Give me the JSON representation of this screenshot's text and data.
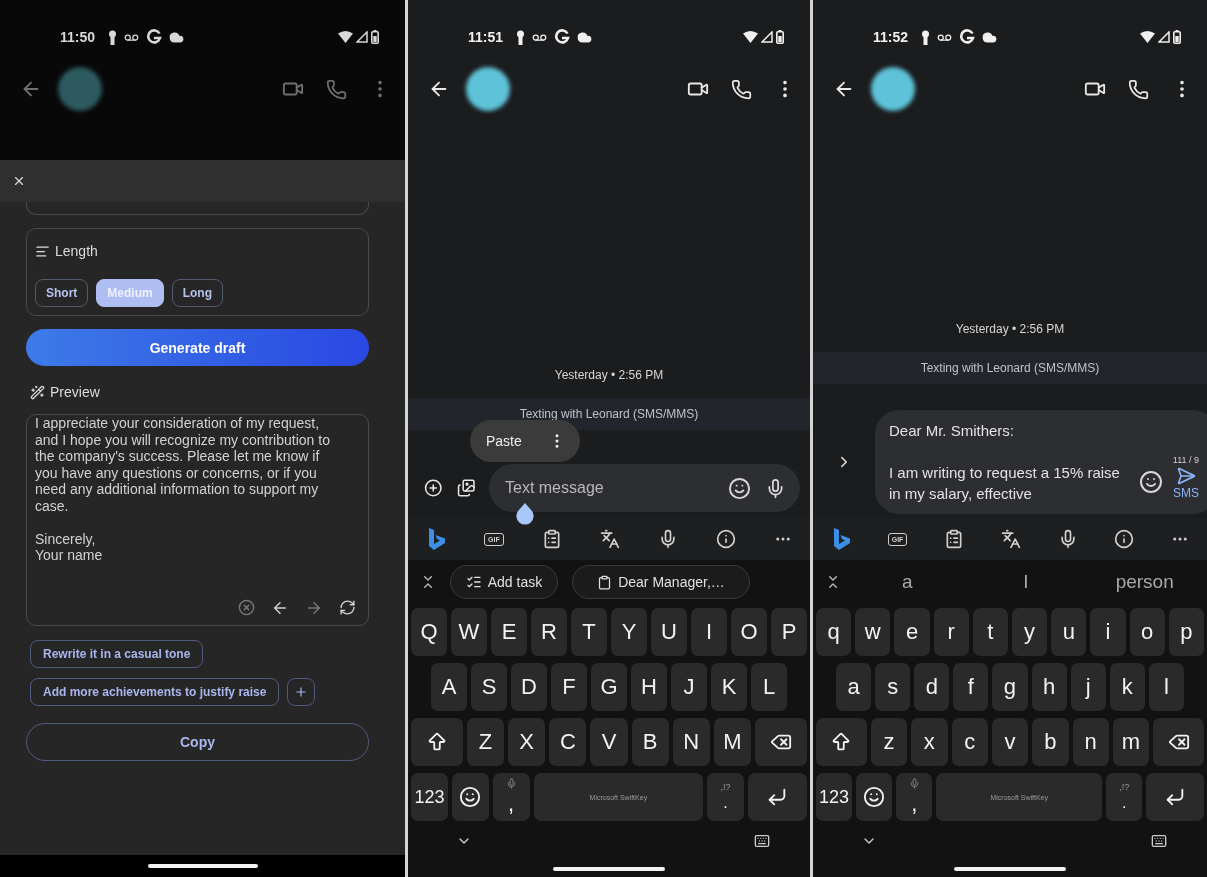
{
  "screens": [
    {
      "kind": "draft",
      "time": "11:50",
      "sheet": {
        "length": {
          "label": "Length",
          "options": [
            {
              "label": "Short",
              "selected": false
            },
            {
              "label": "Medium",
              "selected": true
            },
            {
              "label": "Long",
              "selected": false
            }
          ]
        },
        "generate_label": "Generate draft",
        "preview": {
          "label": "Preview",
          "text": "I appreciate your consideration of my request, and I hope you will recognize my contribution to the company's success. Please let me know if you have any questions or concerns, or if you need any additional information to support my case.\n\nSincerely,\nYour name"
        },
        "prompts": [
          "Rewrite it in a casual tone",
          "Add more achievements to justify raise"
        ],
        "copy_label": "Copy"
      }
    },
    {
      "kind": "chat",
      "time": "11:51",
      "timestamp": "Yesterday • 2:56 PM",
      "banner": "Texting with Leonard (SMS/MMS)",
      "paste_menu": {
        "label": "Paste"
      },
      "compose": {
        "placeholder": "Text message"
      },
      "toolbar": {
        "gif_label": "GIF"
      },
      "suggestions": [
        {
          "kind": "task",
          "label": "Add task"
        },
        {
          "kind": "clip",
          "label": "Dear Manager,…"
        }
      ],
      "keyboard": {
        "rows": [
          [
            "Q",
            "W",
            "E",
            "R",
            "T",
            "Y",
            "U",
            "I",
            "O",
            "P"
          ],
          [
            "A",
            "S",
            "D",
            "F",
            "G",
            "H",
            "J",
            "K",
            "L"
          ],
          [
            "Z",
            "X",
            "C",
            "V",
            "B",
            "N",
            "M"
          ]
        ],
        "number_key": "123",
        "comma": ",",
        "period": ".",
        "period_hint": ",!?",
        "space_label": "Microsoft SwiftKey"
      }
    },
    {
      "kind": "chat",
      "time": "11:52",
      "timestamp": "Yesterday • 2:56 PM",
      "banner": "Texting with Leonard (SMS/MMS)",
      "compose": {
        "value": "Dear Mr. Smithers:\n\nI am writing to request a 15% raise in my salary, effective",
        "counter": "111 / 9",
        "send_label": "SMS"
      },
      "toolbar": {
        "gif_label": "GIF"
      },
      "suggestions": [
        {
          "kind": "word",
          "label": "a"
        },
        {
          "kind": "word",
          "label": "I"
        },
        {
          "kind": "word",
          "label": "person"
        }
      ],
      "keyboard": {
        "rows": [
          [
            "q",
            "w",
            "e",
            "r",
            "t",
            "y",
            "u",
            "i",
            "o",
            "p"
          ],
          [
            "a",
            "s",
            "d",
            "f",
            "g",
            "h",
            "j",
            "k",
            "l"
          ],
          [
            "z",
            "x",
            "c",
            "v",
            "b",
            "n",
            "m"
          ]
        ],
        "number_key": "123",
        "comma": ",",
        "period": ".",
        "period_hint": ",!?",
        "space_label": "Microsoft SwiftKey"
      }
    }
  ]
}
